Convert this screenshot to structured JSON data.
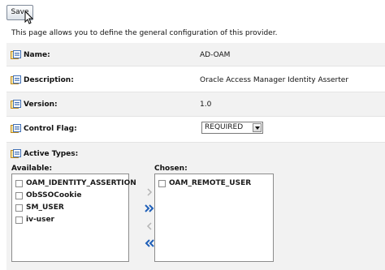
{
  "toolbar": {
    "save_label": "Save"
  },
  "intro_text": "This page allows you to define the general configuration of this provider.",
  "fields": {
    "name": {
      "label": "Name:",
      "value": "AD-OAM"
    },
    "description": {
      "label": "Description:",
      "value": "Oracle Access Manager Identity Asserter"
    },
    "version": {
      "label": "Version:",
      "value": "1.0"
    },
    "control_flag": {
      "label": "Control Flag:",
      "value": "REQUIRED"
    },
    "active_types": {
      "label": "Active Types:"
    }
  },
  "shuttle": {
    "available_label": "Available:",
    "chosen_label": "Chosen:",
    "available": [
      "OAM_IDENTITY_ASSERTION",
      "ObSSOCookie",
      "SM_USER",
      "iv-user"
    ],
    "chosen": [
      "OAM_REMOTE_USER"
    ]
  },
  "colors": {
    "arrow_active": "#1f5fb8",
    "arrow_disabled": "#b5b5b5"
  }
}
